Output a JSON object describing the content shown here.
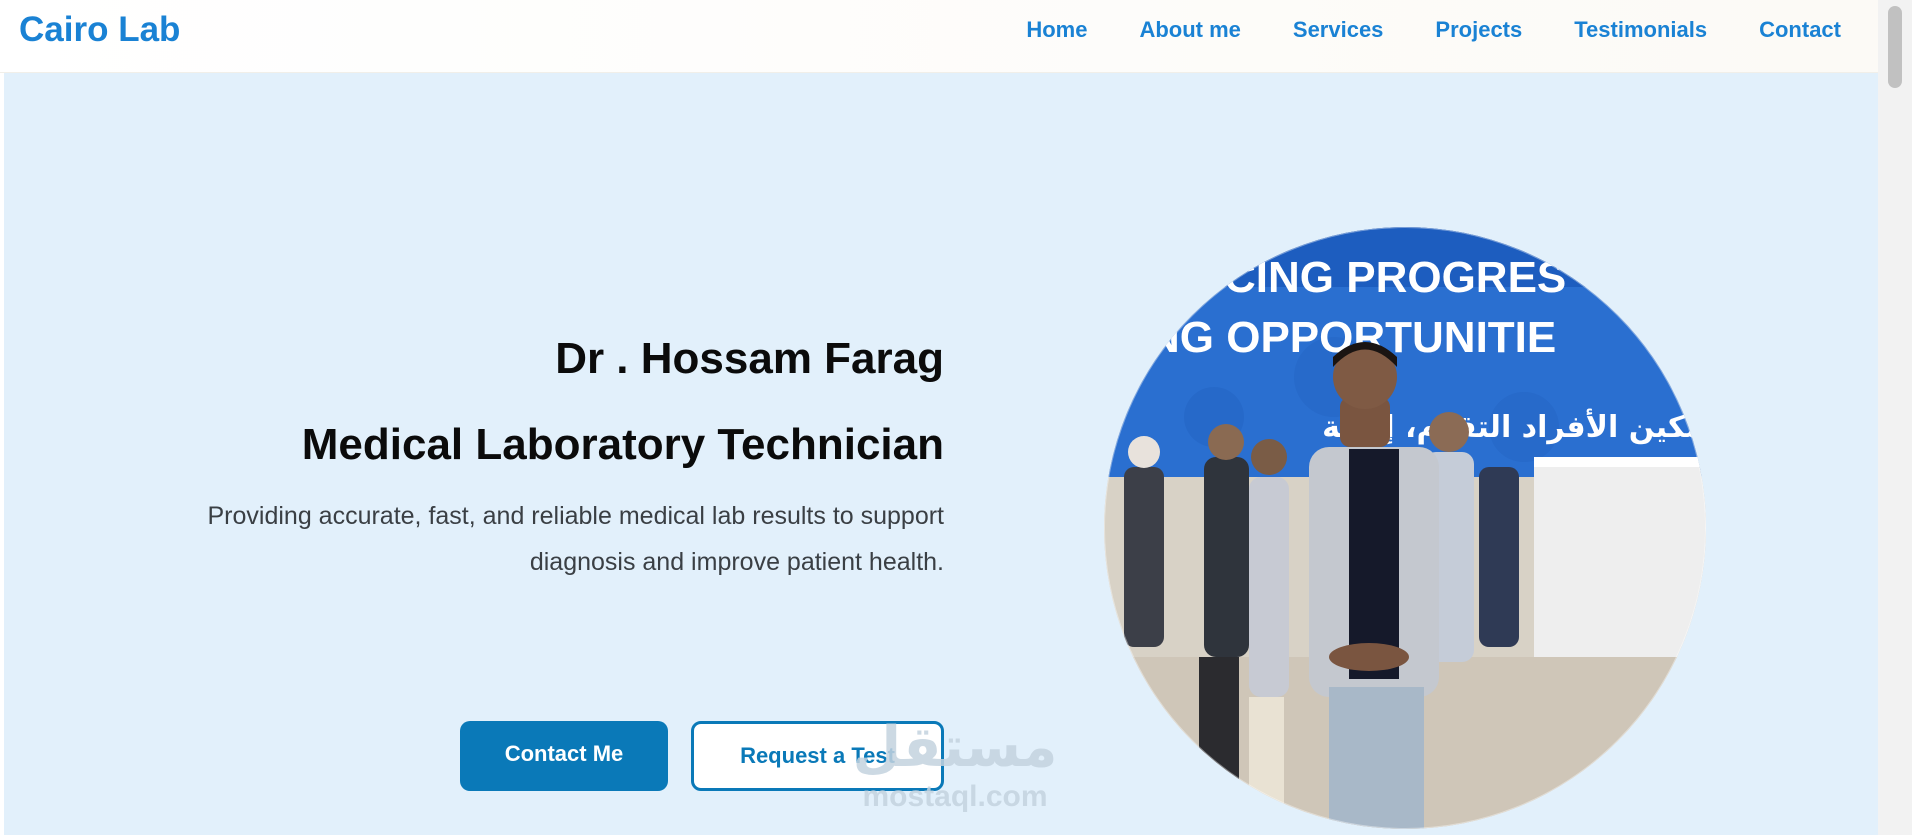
{
  "header": {
    "brand": "Cairo Lab",
    "nav": [
      "Home",
      "About me",
      "Services",
      "Projects",
      "Testimonials",
      "Contact"
    ]
  },
  "hero": {
    "name": "Dr . Hossam Farag",
    "role": "Medical Laboratory Technician",
    "description": "Providing accurate, fast, and reliable medical lab results to support diagnosis and improve patient health.",
    "primary_button": "Contact Me",
    "secondary_button": "Request a Test"
  },
  "photo": {
    "banner_line1": "CING PROGRES",
    "banner_line2": "KING OPPORTUNITIE",
    "banner_line3": "مكين الأفراد التقدم، إتاحة"
  },
  "watermark": {
    "arabic": "مستقل",
    "latin": "mostaql.com"
  },
  "colors": {
    "accent": "#1a82d4",
    "button": "#0a79b8",
    "hero_bg": "#e2f0fb"
  }
}
